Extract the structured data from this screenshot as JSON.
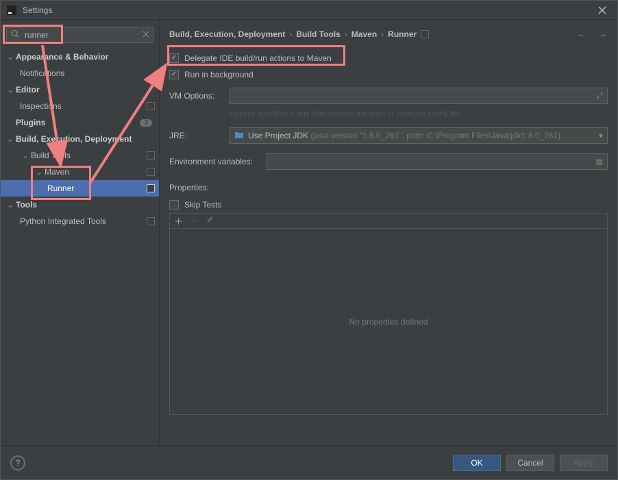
{
  "titlebar": {
    "title": "Settings"
  },
  "search": {
    "value": "runner",
    "placeholder": ""
  },
  "tree": {
    "appearance": "Appearance & Behavior",
    "notifications": "Notifications",
    "editor": "Editor",
    "inspections": "Inspections",
    "plugins": "Plugins",
    "plugins_badge": "3",
    "build": "Build, Execution, Deployment",
    "build_tools": "Build Tools",
    "maven": "Maven",
    "runner": "Runner",
    "tools": "Tools",
    "python_tools": "Python Integrated Tools"
  },
  "breadcrumb": {
    "a": "Build, Execution, Deployment",
    "b": "Build Tools",
    "c": "Maven",
    "d": "Runner"
  },
  "form": {
    "delegate": "Delegate IDE build/run actions to Maven",
    "run_bg": "Run in background",
    "vm_label": "VM Options:",
    "vm_hint": "Options specified in this field override the ones in .mvn/jvm.config file.",
    "jre_label": "JRE:",
    "jre_value_primary": "Use Project JDK",
    "jre_value_detail": "(java version \"1.8.0_261\", path: C:\\Program Files\\Java\\jdk1.8.0_261)",
    "env_label": "Environment variables:",
    "properties_label": "Properties:",
    "skip_tests": "Skip Tests",
    "table_empty": "No properties defined"
  },
  "buttons": {
    "ok": "OK",
    "cancel": "Cancel",
    "apply": "Apply"
  }
}
